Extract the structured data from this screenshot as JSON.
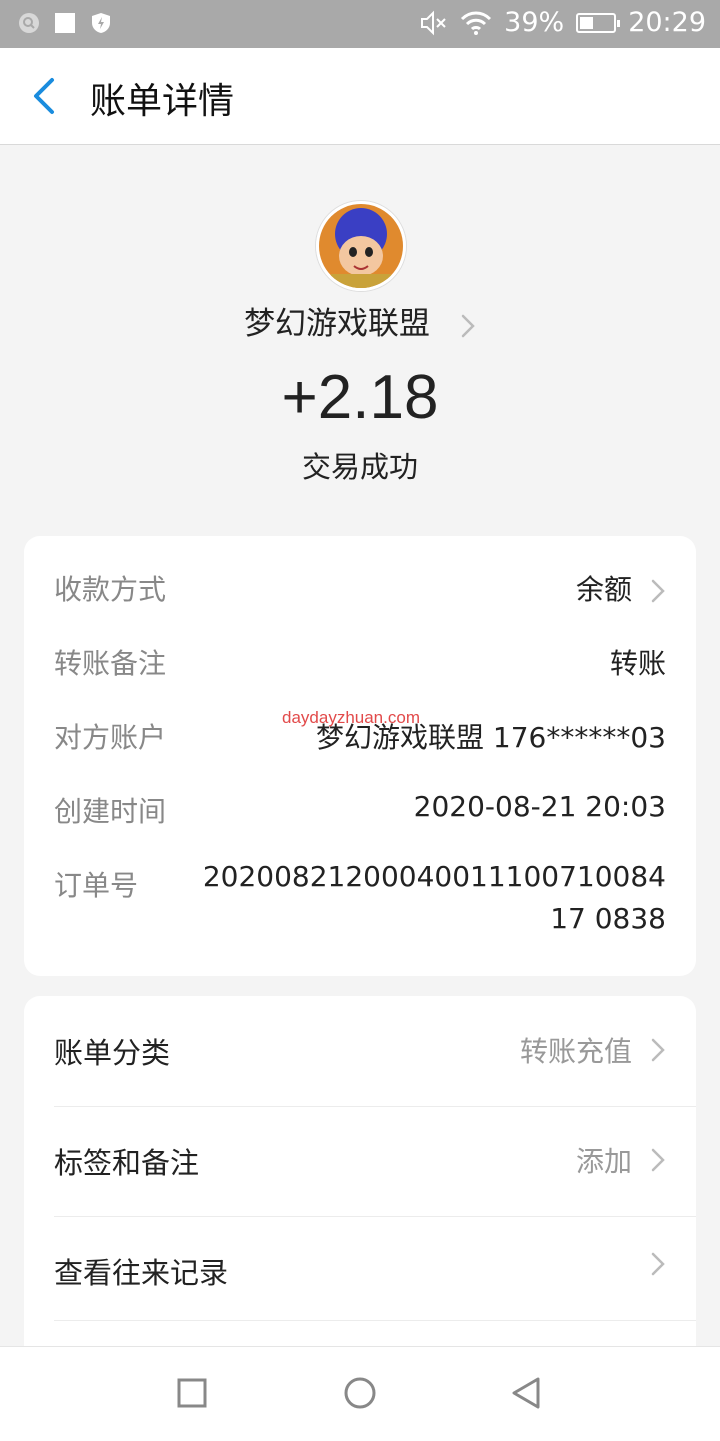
{
  "status_bar": {
    "battery": "39%",
    "battery_level": 0.39,
    "time": "20:29",
    "icons": [
      "search-icon",
      "square-icon",
      "shield-icon",
      "mute-icon",
      "wifi-icon",
      "battery-icon"
    ]
  },
  "header": {
    "title": "账单详情",
    "back_icon": "chevron-left-icon"
  },
  "merchant": {
    "name": "梦幻游戏联盟",
    "amount": "+2.18",
    "status": "交易成功"
  },
  "details": [
    {
      "label": "收款方式",
      "value": "余额",
      "chevron": true
    },
    {
      "label": "转账备注",
      "value": "转账"
    },
    {
      "label": "对方账户",
      "value": "梦幻游戏联盟 176******03"
    },
    {
      "label": "创建时间",
      "value": "2020-08-21 20:03"
    },
    {
      "label": "订单号",
      "value": "2020082120004001110071008417 0838"
    }
  ],
  "watermark": "daydayzhuan.com",
  "actions": [
    {
      "label": "账单分类",
      "value": "转账充值"
    },
    {
      "label": "标签和备注",
      "value": "添加"
    },
    {
      "label": "查看往来记录",
      "value": ""
    }
  ],
  "colors": {
    "accent": "#1a8cde",
    "background": "#f4f4f4",
    "status_bar": "#a9a9a9"
  }
}
